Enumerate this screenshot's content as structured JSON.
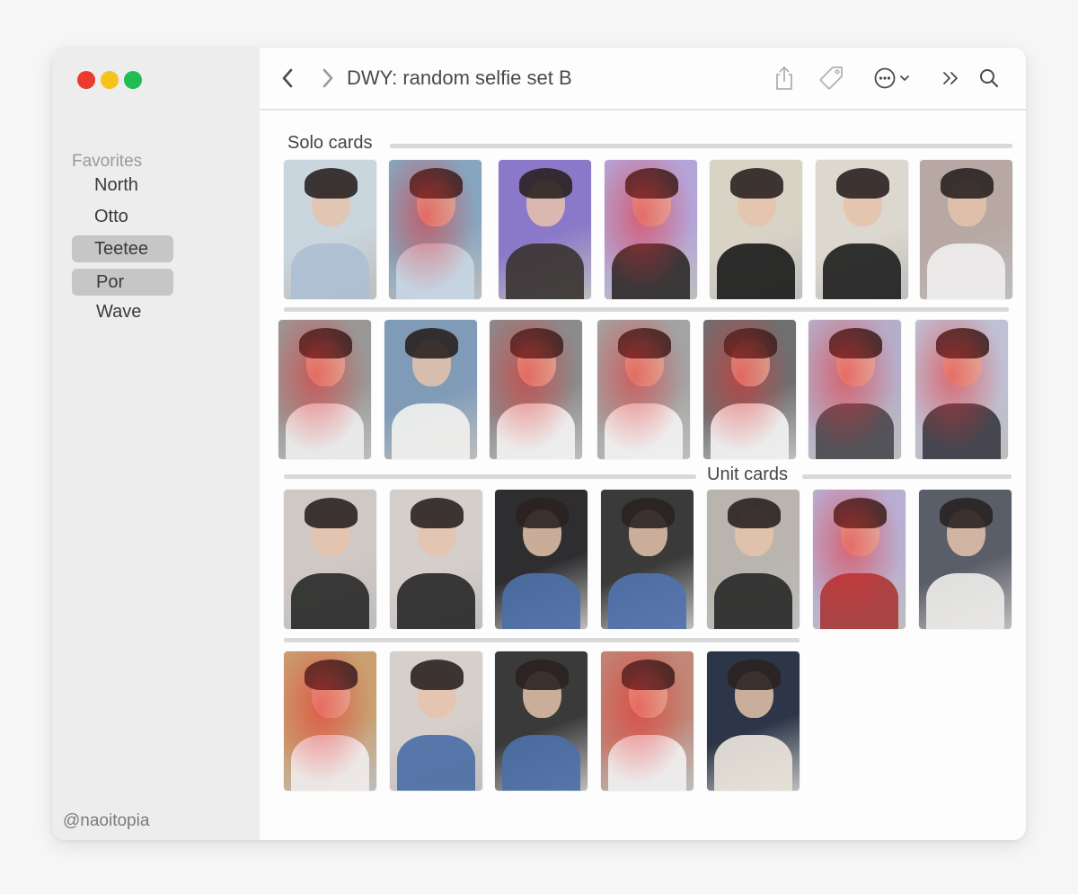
{
  "window": {
    "title": "DWY: random selfie set B"
  },
  "sidebar": {
    "heading": "Favorites",
    "items": [
      {
        "label": "North",
        "selected": false
      },
      {
        "label": "Otto",
        "selected": false
      },
      {
        "label": "Teetee",
        "selected": true
      },
      {
        "label": "Por",
        "selected": true
      },
      {
        "label": "Wave",
        "selected": false
      }
    ],
    "credit": "@naoitopia"
  },
  "toolbar": {
    "icons": [
      "chevron-left-icon",
      "chevron-right-icon",
      "share-icon",
      "tag-icon",
      "more-icon",
      "chevron-down-icon",
      "double-chevron-right-icon",
      "search-icon"
    ]
  },
  "sections": [
    {
      "label": "Solo cards"
    },
    {
      "label": "Unit cards"
    }
  ],
  "cards": {
    "solo_row1": [
      {
        "bg": "#c9d6dd",
        "body": "#aebfd4",
        "tint": false
      },
      {
        "bg": "#86a6c0",
        "body": "#c8d6e4",
        "tint": true
      },
      {
        "bg": "#8a79c9",
        "body": "#3b3533",
        "tint": false
      },
      {
        "bg": "#b4a4d8",
        "body": "#2f2c2c",
        "tint": true
      },
      {
        "bg": "#d9d3c6",
        "body": "#1d1d1d",
        "tint": false
      },
      {
        "bg": "#ddd8cf",
        "body": "#222222",
        "tint": false
      },
      {
        "bg": "#b7a8a3",
        "body": "#efeeee",
        "tint": false
      }
    ],
    "solo_row2": [
      {
        "bg": "#9a9896",
        "body": "#ededed",
        "tint": true
      },
      {
        "bg": "#7f9bb8",
        "body": "#f1f1ee",
        "tint": false
      },
      {
        "bg": "#8c8a8b",
        "body": "#f2f2f2",
        "tint": true
      },
      {
        "bg": "#a3a3a3",
        "body": "#f2f2f2",
        "tint": true
      },
      {
        "bg": "#6f6f70",
        "body": "#f2f2f2",
        "tint": true
      },
      {
        "bg": "#b6adc8",
        "body": "#4a4a50",
        "tint": true
      },
      {
        "bg": "#bfc0d4",
        "body": "#3b3c44",
        "tint": true
      }
    ],
    "unit_row1": [
      {
        "bg": "#cfc8c5",
        "body": "#2b2b2b",
        "tint": false
      },
      {
        "bg": "#d5cfcc",
        "body": "#2a2a2a",
        "tint": false
      },
      {
        "bg": "#2e2e30",
        "body": "#4d6fa6",
        "tint": false
      },
      {
        "bg": "#3a3a3a",
        "body": "#4f72ad",
        "tint": false
      },
      {
        "bg": "#b9b5ae",
        "body": "#2a2a2a",
        "tint": false
      },
      {
        "bg": "#b9aed2",
        "body": "#a83a3a",
        "tint": true
      },
      {
        "bg": "#5a5e68",
        "body": "#eceae8",
        "tint": false
      }
    ],
    "unit_row2": [
      {
        "bg": "#c9a070",
        "body": "#f0ecea",
        "tint": true
      },
      {
        "bg": "#d6cfca",
        "body": "#4d6fa6",
        "tint": false
      },
      {
        "bg": "#3a3a3a",
        "body": "#4d6fa6",
        "tint": false
      },
      {
        "bg": "#c08676",
        "body": "#f0f0f0",
        "tint": true
      },
      {
        "bg": "#2d3648",
        "body": "#e9e3da",
        "tint": false
      }
    ]
  }
}
